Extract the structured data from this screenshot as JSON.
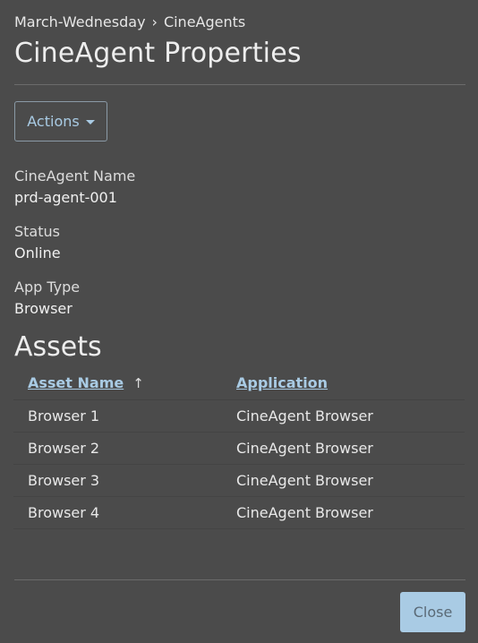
{
  "breadcrumb": {
    "parent": "March-Wednesday",
    "separator": "›",
    "current": "CineAgents"
  },
  "page_title": "CineAgent Properties",
  "actions_button": {
    "label": "Actions",
    "icon": "caret-down-icon"
  },
  "properties": [
    {
      "label": "CineAgent Name",
      "value": "prd-agent-001"
    },
    {
      "label": "Status",
      "value": "Online"
    },
    {
      "label": "App Type",
      "value": "Browser"
    }
  ],
  "assets": {
    "heading": "Assets",
    "columns": [
      {
        "label": "Asset Name",
        "sorted": "ascending",
        "sort_icon": "arrow-up-icon"
      },
      {
        "label": "Application"
      }
    ],
    "rows": [
      {
        "name": "Browser 1",
        "application": "CineAgent Browser"
      },
      {
        "name": "Browser 2",
        "application": "CineAgent Browser"
      },
      {
        "name": "Browser 3",
        "application": "CineAgent Browser"
      },
      {
        "name": "Browser 4",
        "application": "CineAgent Browser"
      }
    ]
  },
  "close_button": {
    "label": "Close"
  },
  "colors": {
    "background": "#4b4b4b",
    "accent": "#a9cbe4",
    "divider": "#6b6b6b"
  }
}
